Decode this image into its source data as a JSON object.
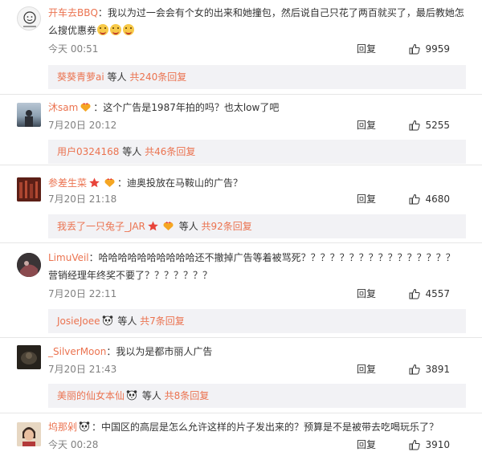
{
  "comments": [
    {
      "username": "开车去BBQ",
      "text_line1": "：我以为过一会会有个女的出来和她撞包，然后说自己只花了两百就买了，最后教她怎",
      "text_line2": "么搜优惠券",
      "time": "今天 00:51",
      "reply_label": "回复",
      "likes": "9959",
      "sub_user": "葵葵青萝ai",
      "sub_mid": " 等人 ",
      "sub_count": "共240条回复"
    },
    {
      "username": "沐sam",
      "text_line1": "：这个广告是1987年拍的吗？也太low了吧",
      "time": "7月20日 20:12",
      "reply_label": "回复",
      "likes": "5255",
      "sub_user": "用户0324168",
      "sub_mid": " 等人 ",
      "sub_count": "共46条回复"
    },
    {
      "username": "参差生菜",
      "text_line1": "：迪奥投放在马鞍山的广告？",
      "time": "7月20日 21:18",
      "reply_label": "回复",
      "likes": "4680",
      "sub_user": "我丢了一只兔子_JAR",
      "sub_mid": " 等人 ",
      "sub_count": "共92条回复"
    },
    {
      "username": "LimuVeil",
      "text_line1": "：哈哈哈哈哈哈哈哈哈哈还不撤掉广告等着被骂死？？？？？？？？？？？？？？？？",
      "text_line2": "营销经理年终奖不要了？？？？？？？",
      "time": "7月20日 22:11",
      "reply_label": "回复",
      "likes": "4557",
      "sub_user": "JosieJoee",
      "sub_mid": " 等人 ",
      "sub_count": "共7条回复"
    },
    {
      "username": "_SilverMoon",
      "text_line1": "：我以为是都市丽人广告",
      "time": "7月20日 21:43",
      "reply_label": "回复",
      "likes": "3891",
      "sub_user": "美丽的仙女本仙",
      "sub_mid": " 等人 ",
      "sub_count": "共8条回复"
    },
    {
      "username": "坞那剁",
      "text_line1": "：中国区的高层是怎么允许这样的片子发出来的？预算是不是被带去吃喝玩乐了？",
      "time": "今天 00:28",
      "reply_label": "回复",
      "likes": "3910"
    }
  ],
  "colors": {
    "link": "#eb7350",
    "subbox_bg": "#f2f2f5",
    "meta_gray": "#808080"
  },
  "icons": {
    "like": "thumbs-up-icon",
    "vip": "heart-crown-vip-icon",
    "star": "red-star-icon",
    "panda": "panda-icon",
    "emoji": "laughing-emoji-icon"
  }
}
